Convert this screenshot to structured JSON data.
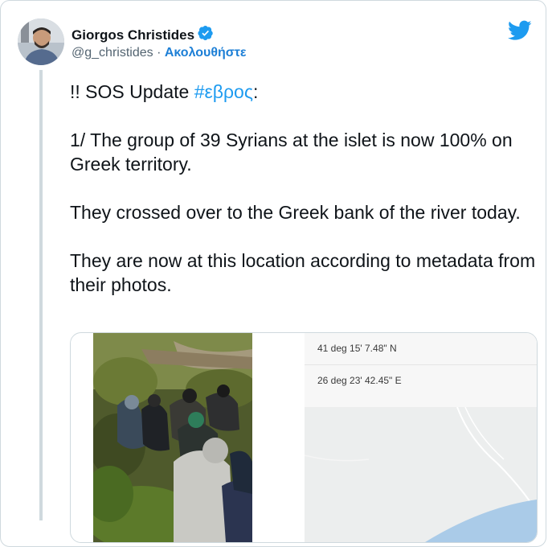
{
  "author": {
    "name": "Giorgos Christides",
    "handle": "@g_christides",
    "separator": "·",
    "follow_label": "Ακολουθήστε"
  },
  "tweet": {
    "line1_prefix": "!! SOS Update ",
    "hashtag": "#εβρος",
    "line1_suffix": ":",
    "para2": "1/ The group of 39 Syrians at the islet is now 100% on Greek territory.",
    "para3": "They crossed over to the Greek bank of the river today.",
    "para4": "They are now at this location according to metadata from their photos."
  },
  "media": {
    "latitude": "41 deg 15' 7.48\" N",
    "longitude": "26 deg 23' 42.45\" E"
  },
  "icons": {
    "verified": "verified-badge-icon",
    "twitter": "twitter-bird-icon"
  },
  "colors": {
    "link": "#1d9bf0",
    "follow": "#1d7fd6",
    "text": "#0f1419",
    "secondary": "#536471"
  }
}
